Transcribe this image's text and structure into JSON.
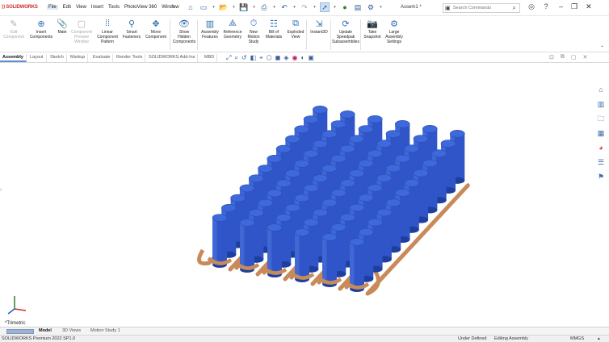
{
  "app": {
    "logo_text": "SOLIDWORKS",
    "document_title": "Assem1 *",
    "menu": [
      "File",
      "Edit",
      "View",
      "Insert",
      "Tools",
      "PhotoView 360",
      "Window"
    ]
  },
  "search": {
    "placeholder": "Search Commands"
  },
  "ribbon": {
    "buttons": [
      {
        "label": "Edit\nComponent",
        "icon": "edit-component-icon",
        "enabled": false
      },
      {
        "label": "Insert\nComponents",
        "icon": "insert-components-icon",
        "enabled": true
      },
      {
        "label": "Mate",
        "icon": "mate-icon",
        "enabled": true
      },
      {
        "label": "Component\nPreview\nWindow",
        "icon": "component-preview-icon",
        "enabled": false
      },
      {
        "label": "Linear\nComponent\nPattern",
        "icon": "linear-pattern-icon",
        "enabled": true
      },
      {
        "label": "Smart\nFasteners",
        "icon": "smart-fasteners-icon",
        "enabled": true
      },
      {
        "label": "Move\nComponent",
        "icon": "move-component-icon",
        "enabled": true
      },
      {
        "label": "Show\nHidden\nComponents",
        "icon": "show-hidden-icon",
        "enabled": true
      },
      {
        "label": "Assembly\nFeatures",
        "icon": "assembly-features-icon",
        "enabled": true
      },
      {
        "label": "Reference\nGeometry",
        "icon": "reference-geometry-icon",
        "enabled": true
      },
      {
        "label": "New\nMotion\nStudy",
        "icon": "motion-study-icon",
        "enabled": true
      },
      {
        "label": "Bill of\nMaterials",
        "icon": "bill-of-materials-icon",
        "enabled": true
      },
      {
        "label": "Exploded\nView",
        "icon": "exploded-view-icon",
        "enabled": true
      },
      {
        "label": "Instant3D",
        "icon": "instant3d-icon",
        "enabled": true
      },
      {
        "label": "Update\nSpeedpak\nSubassemblies",
        "icon": "speedpak-icon",
        "enabled": true
      },
      {
        "label": "Take\nSnapshot",
        "icon": "snapshot-icon",
        "enabled": true
      },
      {
        "label": "Large\nAssembly\nSettings",
        "icon": "large-assembly-icon",
        "enabled": true
      }
    ]
  },
  "command_tabs": [
    "Assembly",
    "Layout",
    "Sketch",
    "Markup",
    "Evaluate",
    "Render Tools",
    "SOLIDWORKS Add-Ins",
    "MBD"
  ],
  "active_command_tab": "Assembly",
  "viewport": {
    "view_name": "*Trimetric",
    "model": {
      "rows": 6,
      "columns": 12,
      "cylinder_color": "#2f55c8",
      "pipe_color": "#c98a5a"
    }
  },
  "bottom_tabs": [
    "Model",
    "3D Views",
    "Motion Study 1"
  ],
  "active_bottom_tab": "Model",
  "status": {
    "version": "SOLIDWORKS Premium 2022 SP1.0",
    "definition": "Under Defined",
    "mode": "Editing Assembly",
    "units": "MMGS"
  }
}
